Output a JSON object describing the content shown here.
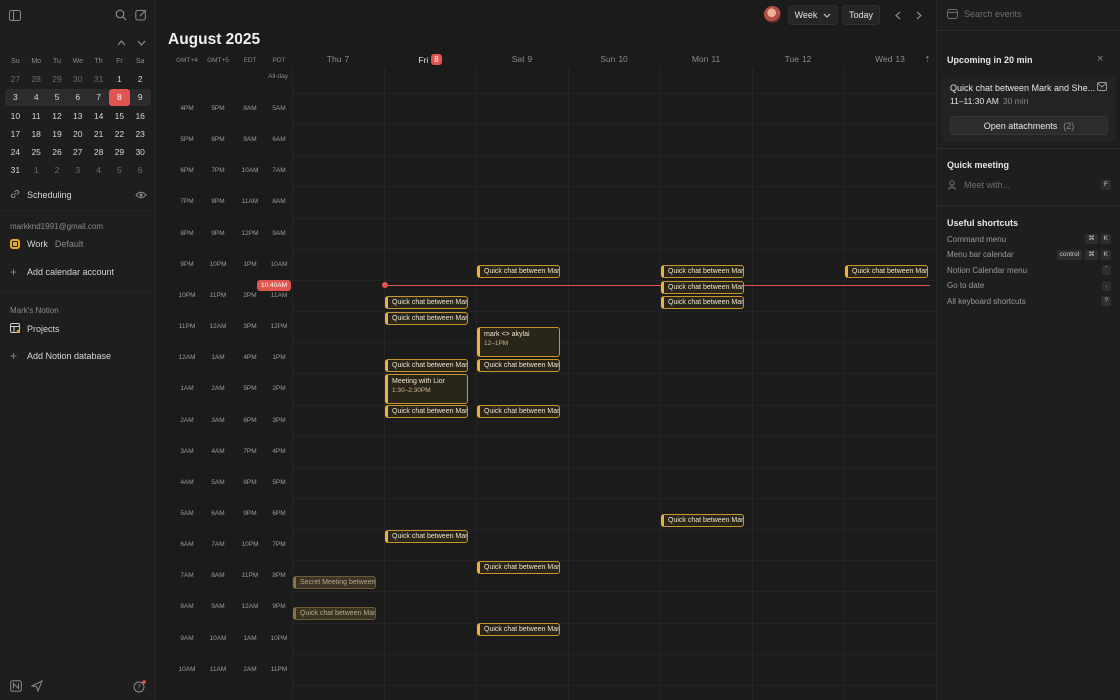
{
  "sidebar": {
    "mini_calendar": {
      "weekdays": [
        "Su",
        "Mo",
        "Tu",
        "We",
        "Th",
        "Fr",
        "Sa"
      ],
      "weeks": [
        [
          "27",
          "28",
          "29",
          "30",
          "31",
          "1",
          "2"
        ],
        [
          "3",
          "4",
          "5",
          "6",
          "7",
          "8",
          "9"
        ],
        [
          "10",
          "11",
          "12",
          "13",
          "14",
          "15",
          "16"
        ],
        [
          "17",
          "18",
          "19",
          "20",
          "21",
          "22",
          "23"
        ],
        [
          "24",
          "25",
          "26",
          "27",
          "28",
          "29",
          "30"
        ],
        [
          "31",
          "1",
          "2",
          "3",
          "4",
          "5",
          "6"
        ]
      ]
    },
    "scheduling_label": "Scheduling",
    "account_email": "markknd1991@gmail.com",
    "calendar_name": "Work",
    "calendar_tag": "Default",
    "add_calendar_label": "Add calendar account",
    "notion_section": "Mark's Notion",
    "projects_label": "Projects",
    "add_notion_label": "Add Notion database"
  },
  "header": {
    "month_title": "August 2025",
    "view_label": "Week",
    "today_label": "Today"
  },
  "timezones": [
    "GMT+4",
    "GMT+5",
    "EDT",
    "PDT"
  ],
  "allday_label": "All-day",
  "days": [
    {
      "name": "Thu",
      "num": "7"
    },
    {
      "name": "Fri",
      "num": "8"
    },
    {
      "name": "Sat",
      "num": "9"
    },
    {
      "name": "Sun",
      "num": "10"
    },
    {
      "name": "Mon",
      "num": "11"
    },
    {
      "name": "Tue",
      "num": "12"
    },
    {
      "name": "Wed",
      "num": "13"
    }
  ],
  "time_rows": [
    [
      "4PM",
      "5PM",
      "8AM",
      "5AM"
    ],
    [
      "5PM",
      "6PM",
      "9AM",
      "6AM"
    ],
    [
      "6PM",
      "7PM",
      "10AM",
      "7AM"
    ],
    [
      "7PM",
      "8PM",
      "11AM",
      "8AM"
    ],
    [
      "8PM",
      "9PM",
      "12PM",
      "9AM"
    ],
    [
      "9PM",
      "10PM",
      "1PM",
      "10AM"
    ],
    [
      "10PM",
      "11PM",
      "2PM",
      "11AM"
    ],
    [
      "11PM",
      "12AM",
      "3PM",
      "12PM"
    ],
    [
      "12AM",
      "1AM",
      "4PM",
      "1PM"
    ],
    [
      "1AM",
      "2AM",
      "5PM",
      "2PM"
    ],
    [
      "2AM",
      "3AM",
      "6PM",
      "3PM"
    ],
    [
      "3AM",
      "4AM",
      "7PM",
      "4PM"
    ],
    [
      "4AM",
      "5AM",
      "8PM",
      "5PM"
    ],
    [
      "5AM",
      "6AM",
      "9PM",
      "6PM"
    ],
    [
      "6AM",
      "7AM",
      "10PM",
      "7PM"
    ],
    [
      "7AM",
      "8AM",
      "11PM",
      "8PM"
    ],
    [
      "8AM",
      "9AM",
      "12AM",
      "9PM"
    ],
    [
      "9AM",
      "10AM",
      "1AM",
      "10PM"
    ],
    [
      "10AM",
      "11AM",
      "2AM",
      "11PM"
    ]
  ],
  "now_label": "10:40AM",
  "events": {
    "quick_chat": "Quick chat between Mark and Sheena",
    "secret_meeting": "Secret Meeting between Mark and Sheena",
    "mark_akylai": "mark <> akylai",
    "mark_akylai_time": "12–1PM",
    "meeting_lior": "Meeting with Lior",
    "meeting_lior_time": "1:30–2:30PM"
  },
  "right_panel": {
    "search_placeholder": "Search events",
    "upcoming_title": "Upcoming in 20 min",
    "event_title": "Quick chat between Mark and She...",
    "event_time": "11–11:30 AM",
    "event_duration": "30 min",
    "attachments_label": "Open attachments",
    "attachments_count": "(2)",
    "quick_meeting_title": "Quick meeting",
    "meet_placeholder": "Meet with...",
    "meet_key": "F",
    "shortcuts_title": "Useful shortcuts",
    "shortcuts": [
      {
        "label": "Command menu",
        "keys": [
          "⌘",
          "K"
        ]
      },
      {
        "label": "Menu bar calendar",
        "keys": [
          "control",
          "⌘",
          "K"
        ]
      },
      {
        "label": "Notion Calendar menu",
        "keys": [
          "`"
        ]
      },
      {
        "label": "Go to date",
        "keys": [
          "."
        ]
      },
      {
        "label": "All keyboard shortcuts",
        "keys": [
          "?"
        ]
      }
    ]
  }
}
